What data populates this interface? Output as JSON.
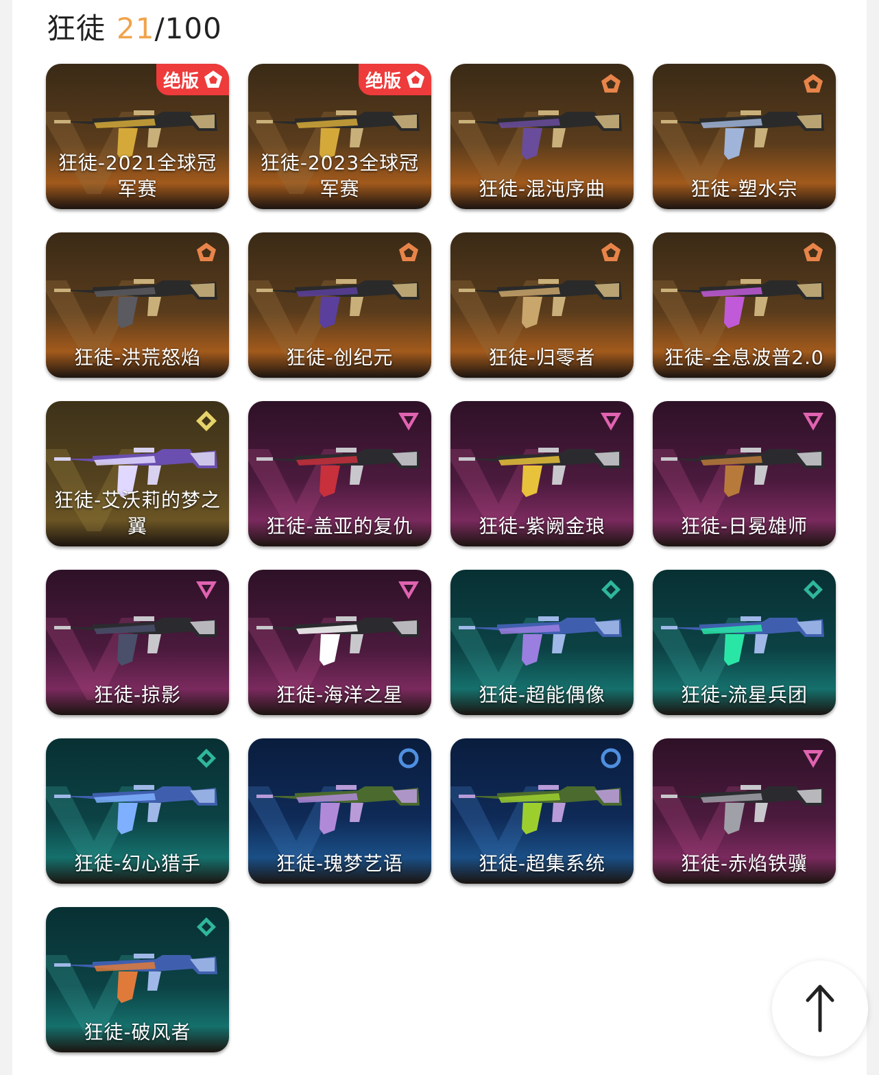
{
  "header": {
    "title": "狂徒",
    "owned": "21",
    "total": "/100"
  },
  "colors": {
    "accent": "#f0a34b",
    "limited_badge": "#ee3b3b",
    "tier_gold": "#3c2b18",
    "tier_purple": "#3a1530",
    "tier_teal": "#0b3b3d",
    "tier_blue": "#0d2348"
  },
  "limited_label": "绝版",
  "skins": [
    {
      "name": "狂徒-2021全球冠军赛",
      "tier": "gold",
      "tier_icon": "pentagon-icon",
      "limited": true
    },
    {
      "name": "狂徒-2023全球冠军赛",
      "tier": "gold",
      "tier_icon": "pentagon-icon",
      "limited": true
    },
    {
      "name": "狂徒-混沌序曲",
      "tier": "gold",
      "tier_icon": "pentagon-icon",
      "limited": false
    },
    {
      "name": "狂徒-塑水宗",
      "tier": "gold",
      "tier_icon": "pentagon-icon",
      "limited": false
    },
    {
      "name": "狂徒-洪荒怒焰",
      "tier": "gold",
      "tier_icon": "pentagon-icon",
      "limited": false
    },
    {
      "name": "狂徒-创纪元",
      "tier": "gold",
      "tier_icon": "pentagon-icon",
      "limited": false
    },
    {
      "name": "狂徒-归零者",
      "tier": "gold",
      "tier_icon": "pentagon-icon",
      "limited": false
    },
    {
      "name": "狂徒-全息波普2.0",
      "tier": "gold",
      "tier_icon": "pentagon-icon",
      "limited": false
    },
    {
      "name": "狂徒-艾沃莉的梦之翼",
      "tier": "olive",
      "tier_icon": "diamond-icon",
      "limited": false
    },
    {
      "name": "狂徒-盖亚的复仇",
      "tier": "purple",
      "tier_icon": "triangle-icon",
      "limited": false
    },
    {
      "name": "狂徒-紫阙金琅",
      "tier": "purple",
      "tier_icon": "triangle-icon",
      "limited": false
    },
    {
      "name": "狂徒-日冕雄师",
      "tier": "purple",
      "tier_icon": "triangle-icon",
      "limited": false
    },
    {
      "name": "狂徒-掠影",
      "tier": "purple",
      "tier_icon": "triangle-icon",
      "limited": false
    },
    {
      "name": "狂徒-海洋之星",
      "tier": "purple",
      "tier_icon": "triangle-icon",
      "limited": false
    },
    {
      "name": "狂徒-超能偶像",
      "tier": "teal",
      "tier_icon": "rhombus-icon",
      "limited": false
    },
    {
      "name": "狂徒-流星兵团",
      "tier": "teal",
      "tier_icon": "rhombus-icon",
      "limited": false
    },
    {
      "name": "狂徒-幻心猎手",
      "tier": "teal",
      "tier_icon": "rhombus-icon",
      "limited": false
    },
    {
      "name": "狂徒-瑰梦艺语",
      "tier": "blue",
      "tier_icon": "circle-icon",
      "limited": false
    },
    {
      "name": "狂徒-超集系统",
      "tier": "blue",
      "tier_icon": "circle-icon",
      "limited": false
    },
    {
      "name": "狂徒-赤焰铁骥",
      "tier": "purple",
      "tier_icon": "triangle-icon",
      "limited": false
    },
    {
      "name": "狂徒-破风者",
      "tier": "teal",
      "tier_icon": "rhombus-icon",
      "limited": false
    }
  ],
  "scroll_top": {
    "icon": "arrow-up-icon"
  }
}
